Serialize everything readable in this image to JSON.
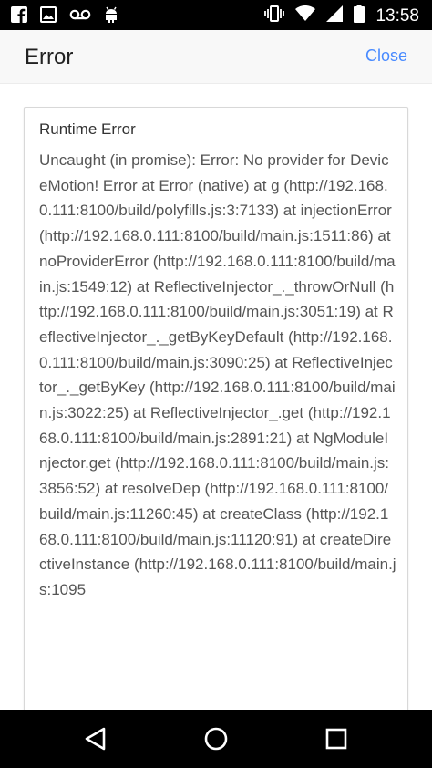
{
  "status_bar": {
    "time": "13:58",
    "left_icons": [
      "facebook-icon",
      "image-icon",
      "voicemail-icon",
      "android-icon"
    ],
    "right_icons": [
      "vibrate-icon",
      "wifi-icon",
      "signal-icon",
      "battery-icon"
    ]
  },
  "header": {
    "title": "Error",
    "close_label": "Close"
  },
  "error": {
    "title": "Runtime Error",
    "message": "Uncaught (in promise): Error: No provider for DeviceMotion! Error at Error (native) at g (http://192.168.0.111:8100/build/polyfills.js:3:7133) at injectionError (http://192.168.0.111:8100/build/main.js:1511:86) at noProviderError (http://192.168.0.111:8100/build/main.js:1549:12) at ReflectiveInjector_._throwOrNull (http://192.168.0.111:8100/build/main.js:3051:19) at ReflectiveInjector_._getByKeyDefault (http://192.168.0.111:8100/build/main.js:3090:25) at ReflectiveInjector_._getByKey (http://192.168.0.111:8100/build/main.js:3022:25) at ReflectiveInjector_.get (http://192.168.0.111:8100/build/main.js:2891:21) at NgModuleInjector.get (http://192.168.0.111:8100/build/main.js:3856:52) at resolveDep (http://192.168.0.111:8100/build/main.js:11260:45) at createClass (http://192.168.0.111:8100/build/main.js:11120:91) at createDirectiveInstance (http://192.168.0.111:8100/build/main.js:1095"
  },
  "nav_bar": {
    "buttons": [
      "back-icon",
      "home-icon",
      "recents-icon"
    ]
  },
  "colors": {
    "accent": "#488aff",
    "status_bar_bg": "#000000",
    "header_bg": "#f8f8f8"
  }
}
